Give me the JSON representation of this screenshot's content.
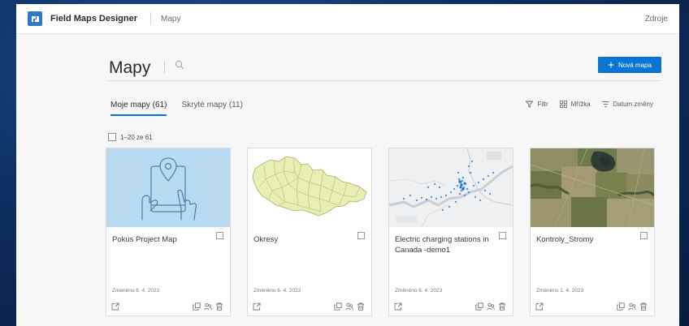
{
  "header": {
    "app_name": "Field Maps Designer",
    "breadcrumb": "Mapy",
    "resources": "Zdroje"
  },
  "main": {
    "title": "Mapy",
    "new_button": "Nová mapa",
    "tabs": [
      {
        "label": "Moje mapy (61)",
        "active": true
      },
      {
        "label": "Skryté mapy (11)",
        "active": false
      }
    ],
    "tools": {
      "filter": "Filtr",
      "grid": "Mřížka",
      "sort": "Datum změny"
    },
    "selection": "1–20 ze 61",
    "cards": [
      {
        "title": "Pokus Project Map",
        "modified": "Změněno 6. 4. 2023",
        "thumb": "tablet-illustration"
      },
      {
        "title": "Okresy",
        "modified": "Změněno 6. 4. 2023",
        "thumb": "czech-districts-map"
      },
      {
        "title": "Electric charging stations in Canada -demo1",
        "modified": "Změněno 6. 4. 2023",
        "thumb": "charging-stations-map"
      },
      {
        "title": "Kontroly_Stromy",
        "modified": "Změněno 1. 4. 2023",
        "thumb": "satellite-imagery"
      }
    ]
  },
  "colors": {
    "accent": "#0a74d4",
    "brand": "#3378c6"
  }
}
